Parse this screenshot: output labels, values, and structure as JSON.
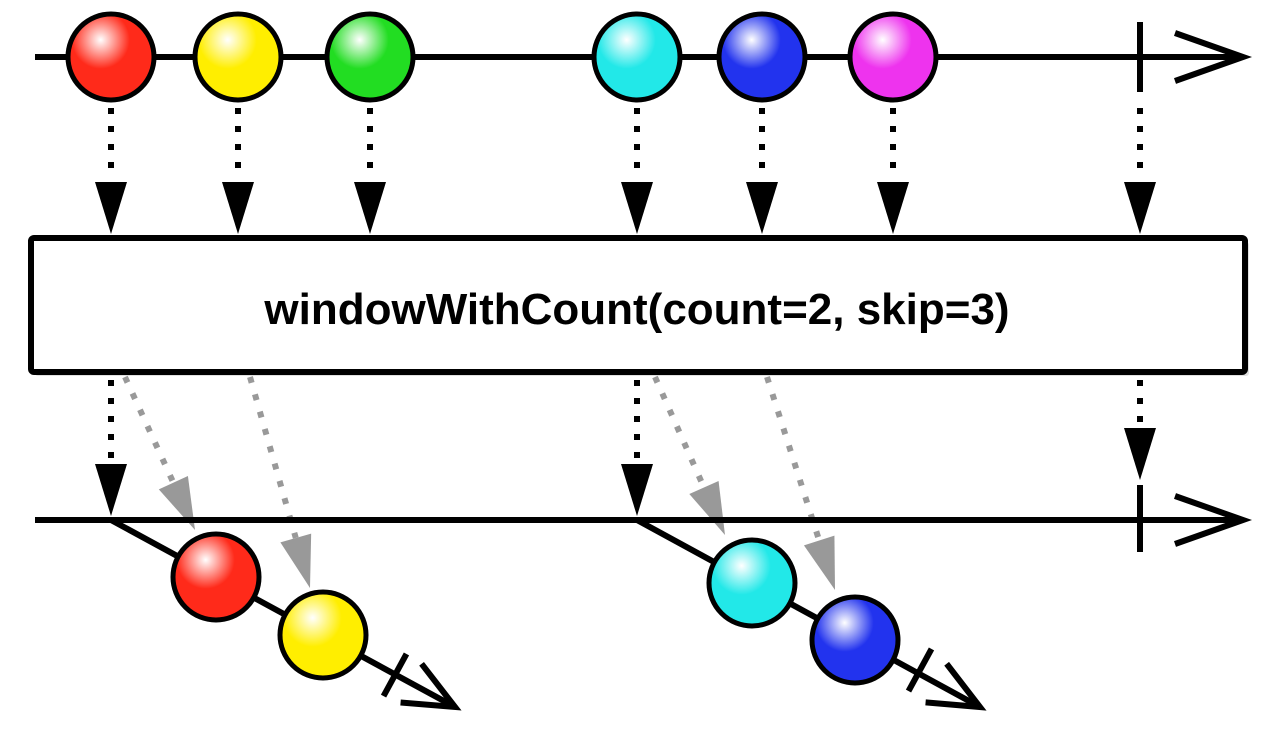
{
  "operator": {
    "label": "windowWithCount(count=2, skip=3)"
  },
  "colors": {
    "line": "#000000",
    "arrow_black": "#000000",
    "arrow_gray": "#999999",
    "box_fill": "#ffffff"
  },
  "input_stream": {
    "marbles": [
      {
        "name": "red",
        "color": "#ff2a1a"
      },
      {
        "name": "yellow",
        "color": "#ffee00"
      },
      {
        "name": "green",
        "color": "#22dd22"
      },
      {
        "name": "cyan",
        "color": "#22e8e8"
      },
      {
        "name": "blue",
        "color": "#2233ee"
      },
      {
        "name": "magenta",
        "color": "#ee33ee"
      }
    ],
    "completes": true
  },
  "output_stream": {
    "windows": [
      {
        "marbles": [
          {
            "name": "red",
            "color": "#ff2a1a"
          },
          {
            "name": "yellow",
            "color": "#ffee00"
          }
        ],
        "completes": true
      },
      {
        "marbles": [
          {
            "name": "cyan",
            "color": "#22e8e8"
          },
          {
            "name": "blue",
            "color": "#2233ee"
          }
        ],
        "completes": true
      }
    ],
    "completes": true
  }
}
